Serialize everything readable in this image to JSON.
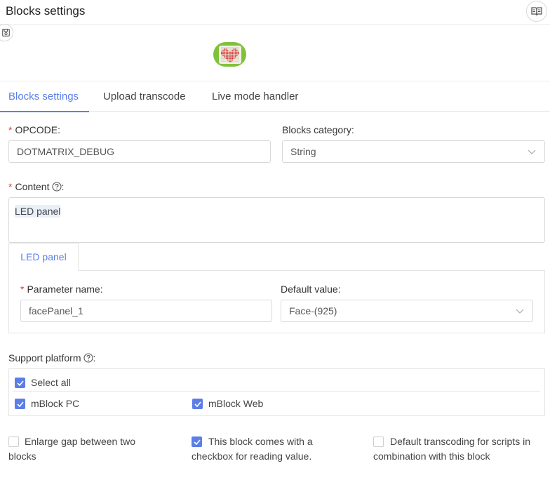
{
  "header": {
    "title": "Blocks settings",
    "book_icon": "book-icon",
    "save_icon": "save-icon"
  },
  "tabs": [
    {
      "label": "Blocks settings",
      "active": true
    },
    {
      "label": "Upload transcode",
      "active": false
    },
    {
      "label": "Live mode handler",
      "active": false
    }
  ],
  "form": {
    "opcode": {
      "label": "OPCODE",
      "value": "DOTMATRIX_DEBUG"
    },
    "category": {
      "label": "Blocks category",
      "value": "String"
    },
    "content": {
      "label": "Content",
      "value": "LED panel"
    },
    "param_tab": {
      "label": "LED panel"
    },
    "param_name": {
      "label": "Parameter name",
      "value": "facePanel_1"
    },
    "default_value": {
      "label": "Default value",
      "value": "Face-(925)"
    }
  },
  "platform": {
    "label": "Support platform",
    "select_all": {
      "label": "Select all",
      "checked": true
    },
    "pc": {
      "label": "mBlock PC",
      "checked": true
    },
    "web": {
      "label": "mBlock Web",
      "checked": true
    }
  },
  "options": {
    "gap": {
      "label": "Enlarge gap between two blocks",
      "checked": false
    },
    "checkbox": {
      "label": "This block comes with a checkbox for reading value.",
      "checked": true
    },
    "transcode": {
      "label": "Default transcoding for scripts in combination with this block",
      "checked": false
    }
  },
  "colors": {
    "accent": "#5b7ee8",
    "required": "#e0403a",
    "preview_green": "#7fc23a",
    "heart": "#d0342c"
  }
}
